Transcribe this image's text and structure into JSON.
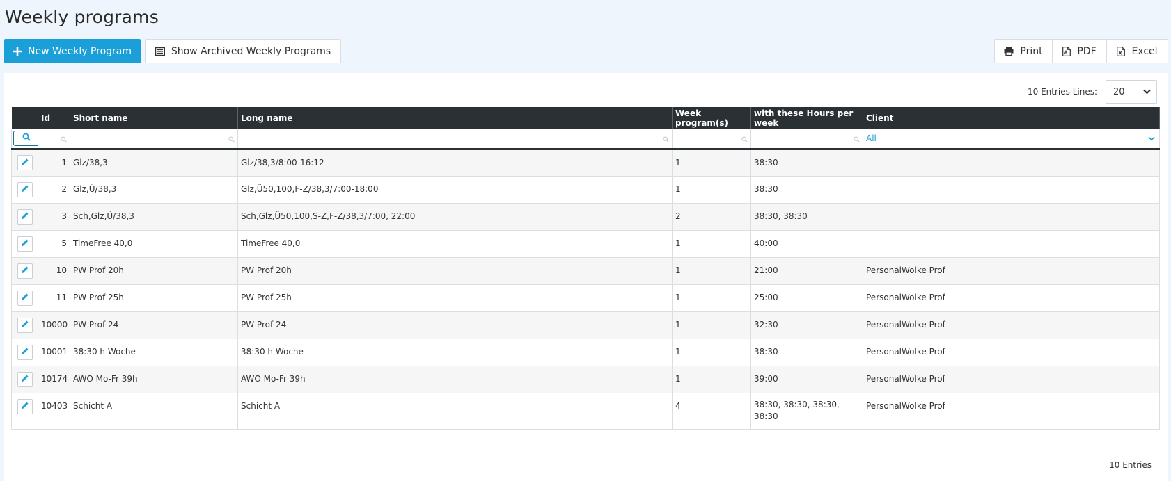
{
  "page": {
    "title": "Weekly programs"
  },
  "toolbar": {
    "new_label": "New Weekly Program",
    "archived_label": "Show Archived Weekly Programs",
    "print_label": "Print",
    "pdf_label": "PDF",
    "excel_label": "Excel"
  },
  "table_controls": {
    "lines_label": "10 Entries Lines:",
    "lines_value": "20"
  },
  "table": {
    "columns": [
      "Id",
      "Short name",
      "Long name",
      "Week program(s)",
      "with these Hours per week",
      "Client"
    ],
    "client_filter": "All",
    "rows": [
      {
        "id": "1",
        "short": "Glz/38,3",
        "long": "Glz/38,3/8:00-16:12",
        "week": "1",
        "hours": "38:30",
        "client": ""
      },
      {
        "id": "2",
        "short": "Glz,Ü/38,3",
        "long": "Glz,Ü50,100,F-Z/38,3/7:00-18:00",
        "week": "1",
        "hours": "38:30",
        "client": ""
      },
      {
        "id": "3",
        "short": "Sch,Glz,Ü/38,3",
        "long": "Sch,Glz,Ü50,100,S-Z,F-Z/38,3/7:00, 22:00",
        "week": "2",
        "hours": "38:30, 38:30",
        "client": ""
      },
      {
        "id": "5",
        "short": "TimeFree 40,0",
        "long": "TimeFree 40,0",
        "week": "1",
        "hours": "40:00",
        "client": ""
      },
      {
        "id": "10",
        "short": "PW Prof 20h",
        "long": "PW Prof 20h",
        "week": "1",
        "hours": "21:00",
        "client": "PersonalWolke Prof"
      },
      {
        "id": "11",
        "short": "PW Prof 25h",
        "long": "PW Prof 25h",
        "week": "1",
        "hours": "25:00",
        "client": "PersonalWolke Prof"
      },
      {
        "id": "10000",
        "short": "PW Prof 24",
        "long": "PW Prof 24",
        "week": "1",
        "hours": "32:30",
        "client": "PersonalWolke Prof"
      },
      {
        "id": "10001",
        "short": "38:30 h Woche",
        "long": "38:30 h Woche",
        "week": "1",
        "hours": "38:30",
        "client": "PersonalWolke Prof"
      },
      {
        "id": "10174",
        "short": "AWO Mo-Fr 39h",
        "long": "AWO Mo-Fr 39h",
        "week": "1",
        "hours": "39:00",
        "client": "PersonalWolke Prof"
      },
      {
        "id": "10403",
        "short": "Schicht A",
        "long": "Schicht A",
        "week": "4",
        "hours": "38:30, 38:30, 38:30, 38:30",
        "client": "PersonalWolke Prof"
      }
    ]
  },
  "footer": {
    "count_label": "10 Entries"
  },
  "colors": {
    "accent": "#1a9fd8",
    "header_bg": "#2b3035",
    "page_bg": "#eef5fc"
  },
  "icons": {
    "new": "plus-icon",
    "archived": "list-icon",
    "print": "printer-icon",
    "pdf": "pdf-file-icon",
    "excel": "excel-file-icon",
    "edit": "pencil-icon",
    "filter": "search-icon",
    "select": "chevron-down-icon"
  }
}
